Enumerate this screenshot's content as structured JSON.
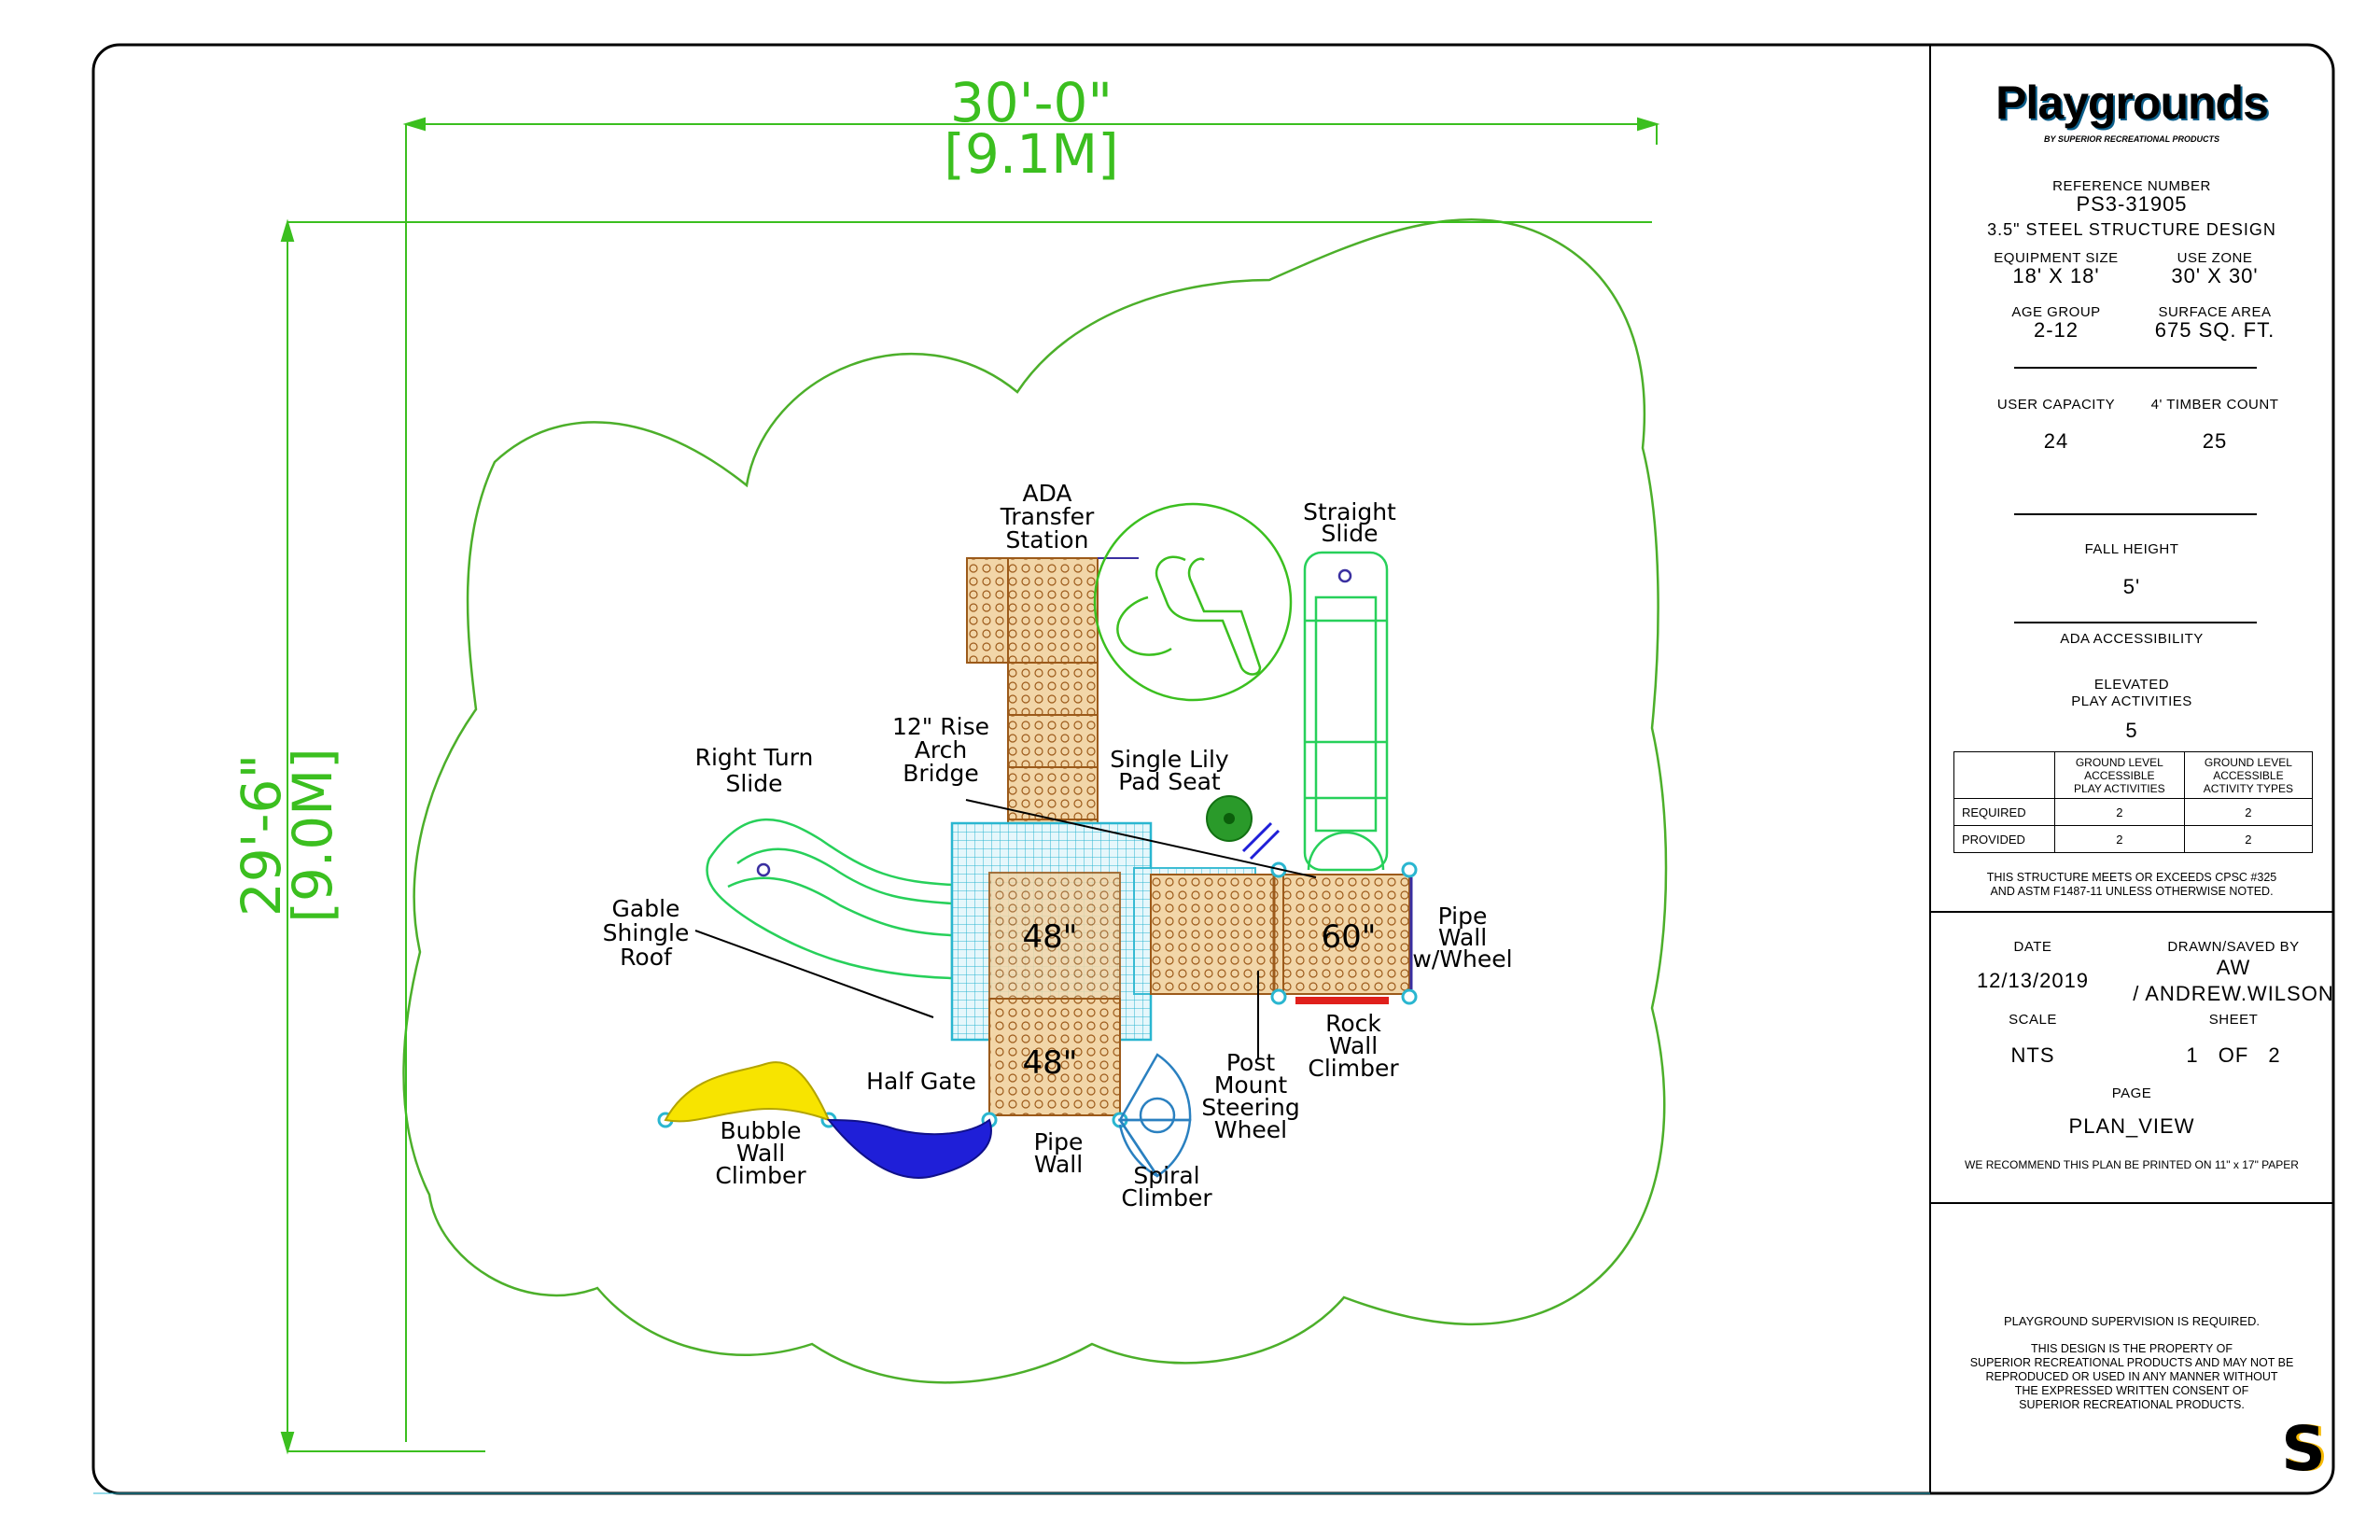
{
  "dimensions": {
    "width_ft": "30'-0\"",
    "width_m": "[9.1M]",
    "height_ft": "29'-6\"",
    "height_m": "[9.0M]"
  },
  "callouts": {
    "ada_transfer": [
      "ADA",
      "Transfer",
      "Station"
    ],
    "straight_slide": [
      "Straight",
      "Slide"
    ],
    "rise_bridge": [
      "12\" Rise",
      "Arch",
      "Bridge"
    ],
    "lily_pad": [
      "Single Lily",
      "Pad Seat"
    ],
    "right_turn_slide": [
      "Right Turn",
      "Slide"
    ],
    "gable_roof": [
      "Gable",
      "Shingle",
      "Roof"
    ],
    "pipe_wall_wheel": [
      "Pipe",
      "Wall",
      "w/Wheel"
    ],
    "rock_wall": [
      "Rock",
      "Wall",
      "Climber"
    ],
    "half_gate": "Half Gate",
    "post_mount": [
      "Post",
      "Mount",
      "Steering",
      "Wheel"
    ],
    "bubble_wall": [
      "Bubble",
      "Wall",
      "Climber"
    ],
    "pipe_wall": [
      "Pipe",
      "Wall"
    ],
    "spiral_climber": [
      "Spiral",
      "Climber"
    ]
  },
  "deck_heights": {
    "deck_a": "48\"",
    "deck_b": "60\"",
    "deck_c": "48\""
  },
  "colors": {
    "dimension_green": "#3bbf1f",
    "use_zone_green": "#4caf2a",
    "deck_brown": "#9c5a1a",
    "roof_cyan": "#2ab6d0",
    "slide_green": "#27d05a",
    "bubble_yellow": "#f7e400",
    "bubble_blue": "#1f1fd8",
    "rock_red": "#e0201c",
    "logo_blue": "#29a7e1"
  },
  "title_block": {
    "logo_main": "Playgrounds",
    "logo_sub": "BY SUPERIOR RECREATIONAL PRODUCTS",
    "reference_label": "REFERENCE NUMBER",
    "reference_value": "PS3-31905",
    "design": "3.5\" STEEL STRUCTURE DESIGN",
    "equipment_size_label": "EQUIPMENT SIZE",
    "equipment_size_value": "18' X 18'",
    "use_zone_label": "USE ZONE",
    "use_zone_value": "30' X 30'",
    "age_group_label": "AGE GROUP",
    "age_group_value": "2-12",
    "surface_area_label": "SURFACE AREA",
    "surface_area_value": "675 SQ. FT.",
    "user_capacity_label": "USER CAPACITY",
    "user_capacity_value": "24",
    "timber_count_label": "4' TIMBER COUNT",
    "timber_count_value": "25",
    "fall_height_label": "FALL HEIGHT",
    "fall_height_value": "5'",
    "ada_label": "ADA ACCESSIBILITY",
    "elevated_label_1": "ELEVATED",
    "elevated_label_2": "PLAY ACTIVITIES",
    "elevated_value": "5",
    "table": {
      "col1": [
        "GROUND LEVEL",
        "ACCESSIBLE",
        "PLAY ACTIVITIES"
      ],
      "col2": [
        "GROUND LEVEL",
        "ACCESSIBLE",
        "ACTIVITY TYPES"
      ],
      "rows": [
        {
          "label": "REQUIRED",
          "a": "2",
          "b": "2"
        },
        {
          "label": "PROVIDED",
          "a": "2",
          "b": "2"
        }
      ]
    },
    "compliance_1": "THIS STRUCTURE MEETS OR EXCEEDS CPSC #325",
    "compliance_2": "AND ASTM F1487-11 UNLESS OTHERWISE NOTED.",
    "date_label": "DATE",
    "date_value": "12/13/2019",
    "drawn_label": "DRAWN/SAVED BY",
    "drawn_value_1": "AW",
    "drawn_value_2": "/ ANDREW.WILSON",
    "scale_label": "SCALE",
    "scale_value": "NTS",
    "sheet_label": "SHEET",
    "sheet_value": "1 OF 2",
    "page_label": "PAGE",
    "page_value": "PLAN_VIEW",
    "print_note": "WE RECOMMEND THIS PLAN BE PRINTED ON 11\" x 17\" PAPER",
    "supervision": "PLAYGROUND SUPERVISION IS REQUIRED.",
    "property_1": "THIS DESIGN IS THE PROPERTY OF",
    "property_2": "SUPERIOR RECREATIONAL PRODUCTS AND MAY NOT BE",
    "property_3": "REPRODUCED OR USED IN ANY MANNER WITHOUT",
    "property_4": "THE EXPRESSED WRITTEN CONSENT OF",
    "property_5": "SUPERIOR RECREATIONAL PRODUCTS.",
    "corner_logo": "S"
  }
}
